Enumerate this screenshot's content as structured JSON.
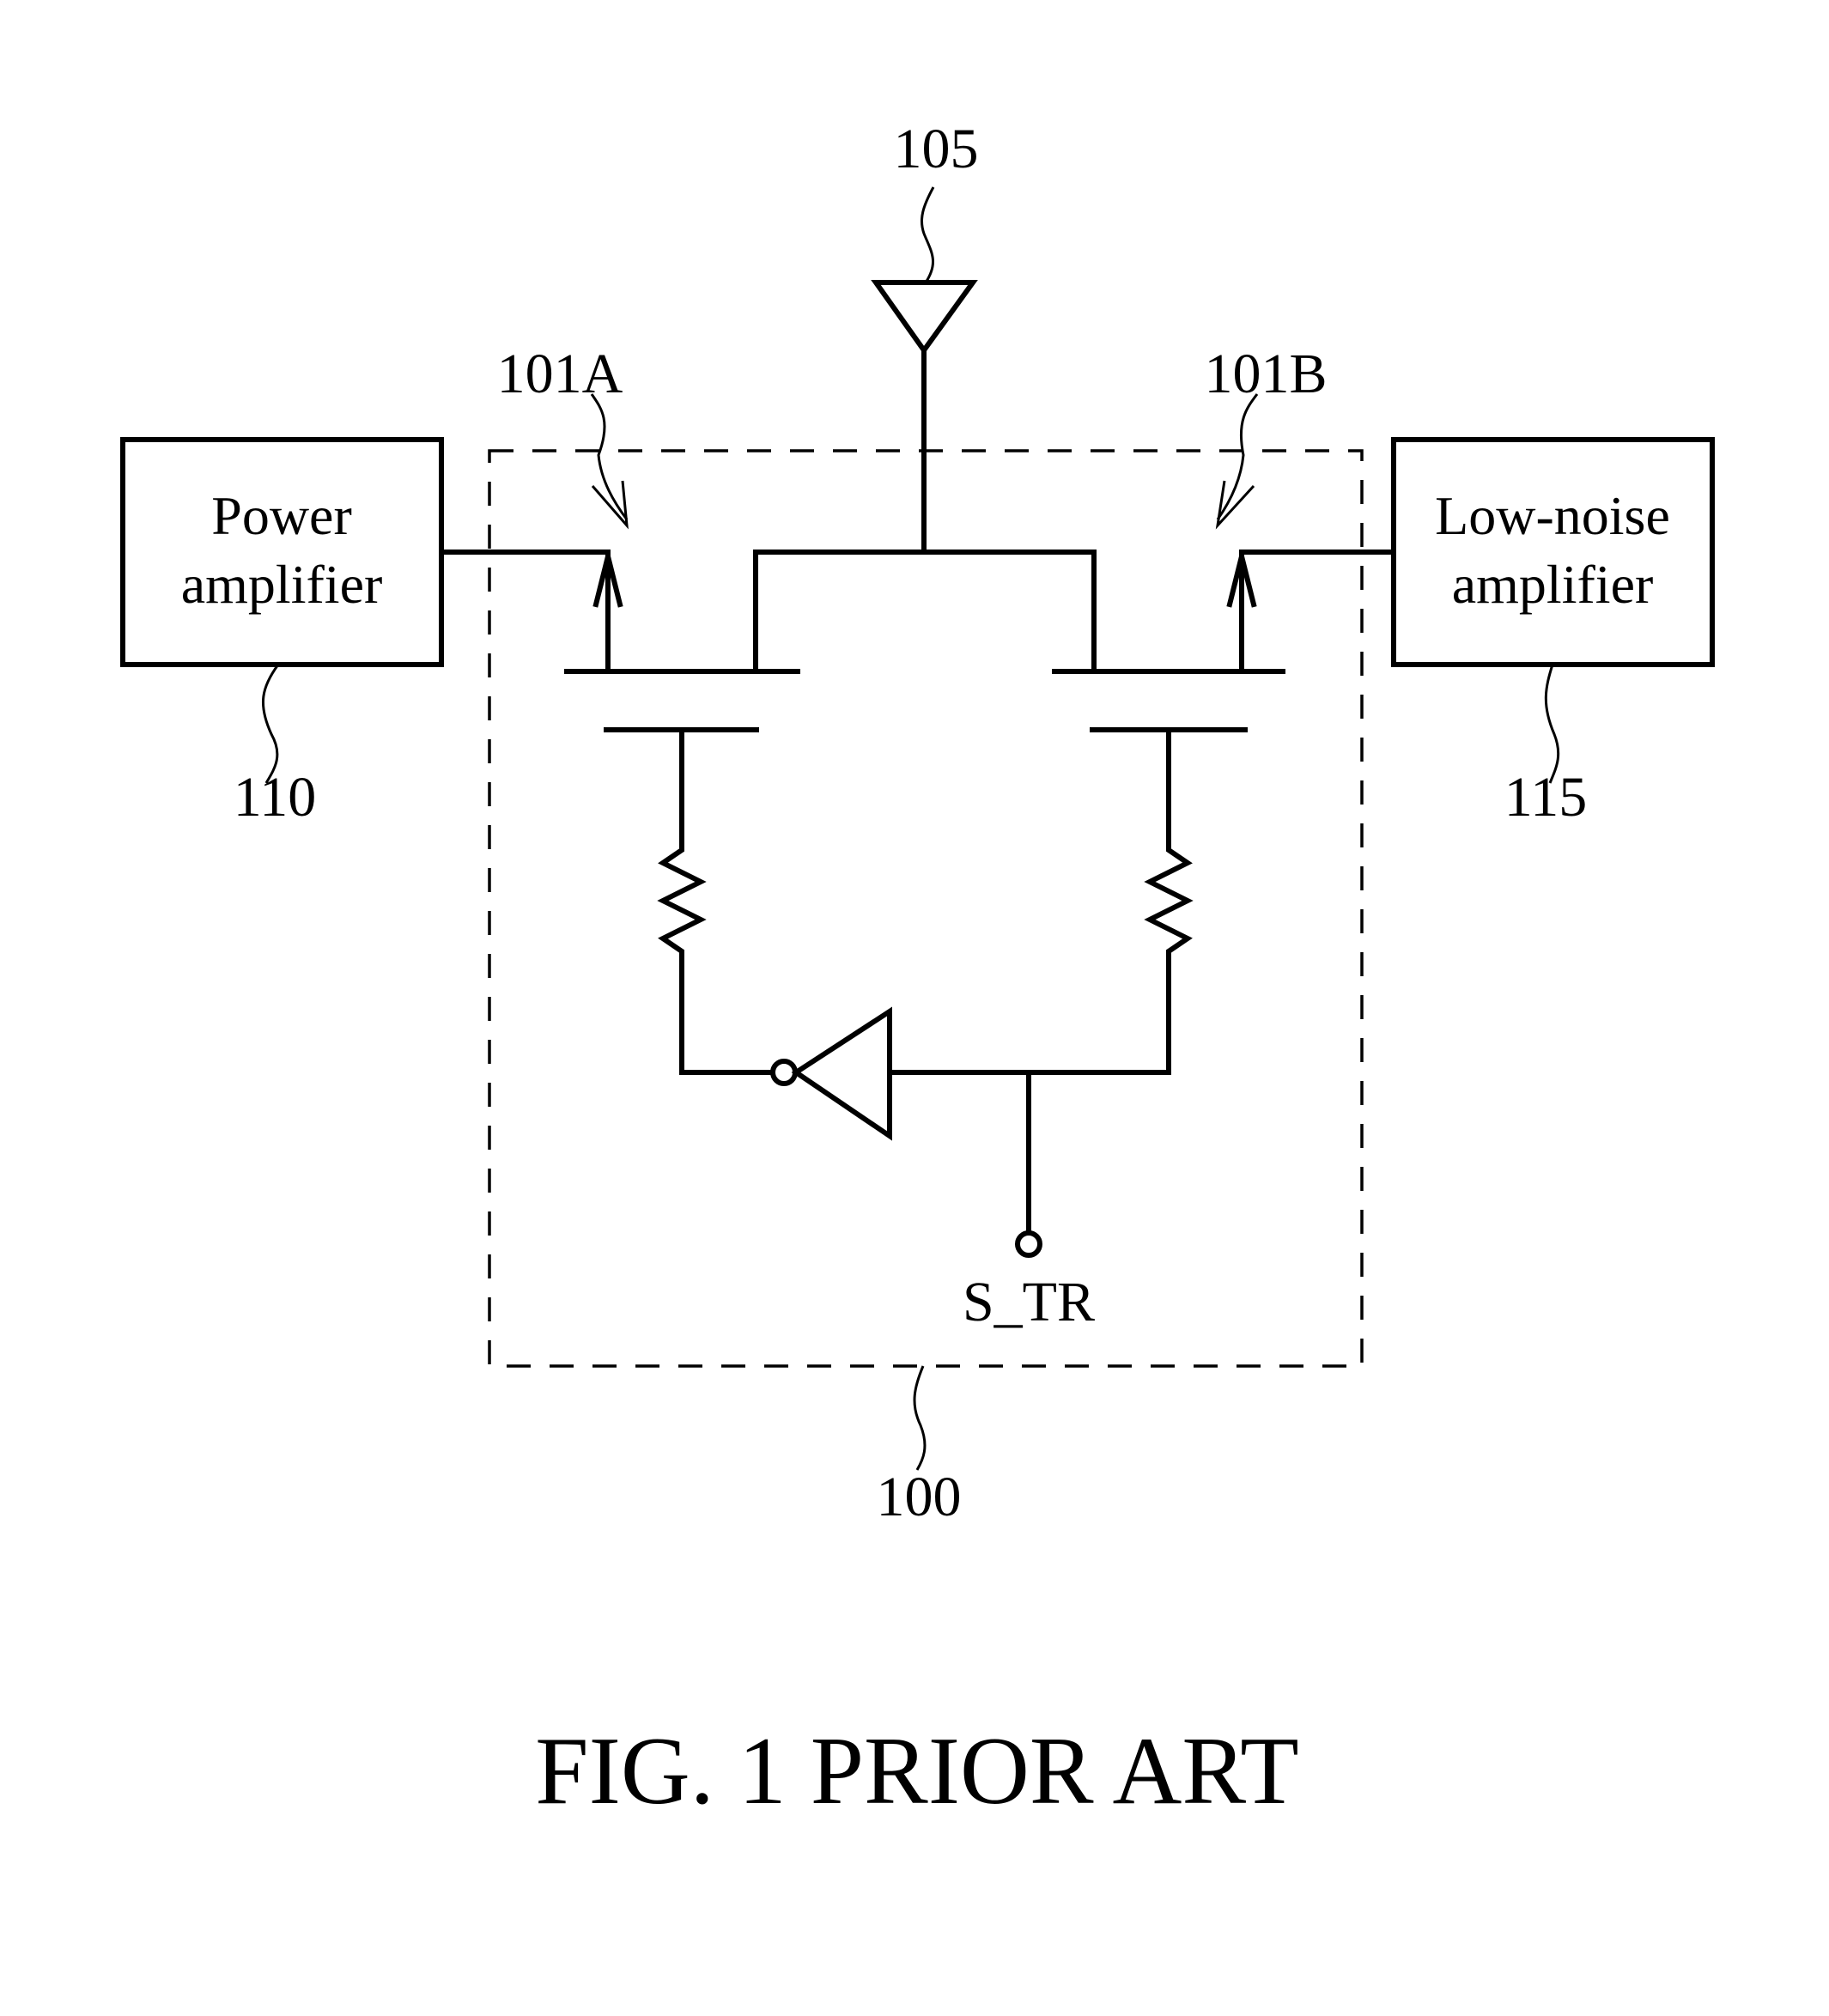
{
  "figure": {
    "caption": "FIG. 1 PRIOR ART"
  },
  "blocks": {
    "power_amplifier": {
      "line1": "Power",
      "line2": "amplifier",
      "ref": "110"
    },
    "low_noise_amplifier": {
      "line1": "Low-noise",
      "line2": "amplifier",
      "ref": "115"
    }
  },
  "switch": {
    "ref": "100",
    "transistor_a_ref": "101A",
    "transistor_b_ref": "101B",
    "control_signal": "S_TR"
  },
  "antenna": {
    "ref": "105"
  },
  "colors": {
    "line": "#000000",
    "background": "#ffffff"
  }
}
